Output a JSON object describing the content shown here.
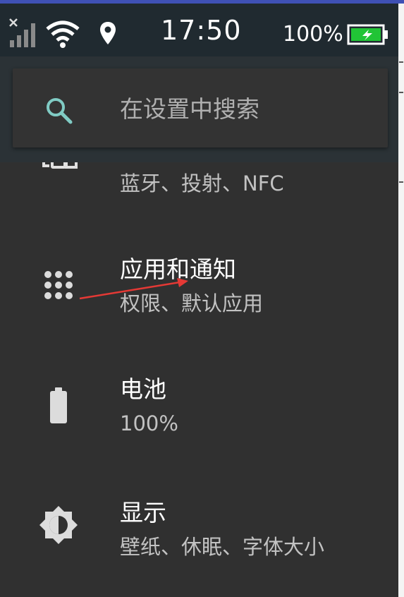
{
  "status_bar": {
    "time": "17:50",
    "battery_percent": "100%",
    "battery_level": 1.0,
    "icons": [
      "signal-off-icon",
      "wifi-icon",
      "location-icon",
      "battery-charging-icon"
    ]
  },
  "search": {
    "placeholder": "在设置中搜索",
    "icon": "search-icon"
  },
  "settings": [
    {
      "id": "connected-devices",
      "icon": "connected-devices-icon",
      "title": "",
      "summary": "蓝牙、投射、NFC"
    },
    {
      "id": "apps",
      "icon": "apps-grid-icon",
      "title": "应用和通知",
      "summary": "权限、默认应用"
    },
    {
      "id": "battery",
      "icon": "battery-icon",
      "title": "电池",
      "summary": "100%"
    },
    {
      "id": "display",
      "icon": "brightness-icon",
      "title": "显示",
      "summary": "壁纸、休眠、字体大小"
    }
  ],
  "colors": {
    "background": "#303030",
    "status_bar": "#202a30",
    "search_card": "#333333",
    "search_icon": "#80cbc4",
    "annotation": "#e53935",
    "battery_fill": "#21c436"
  }
}
